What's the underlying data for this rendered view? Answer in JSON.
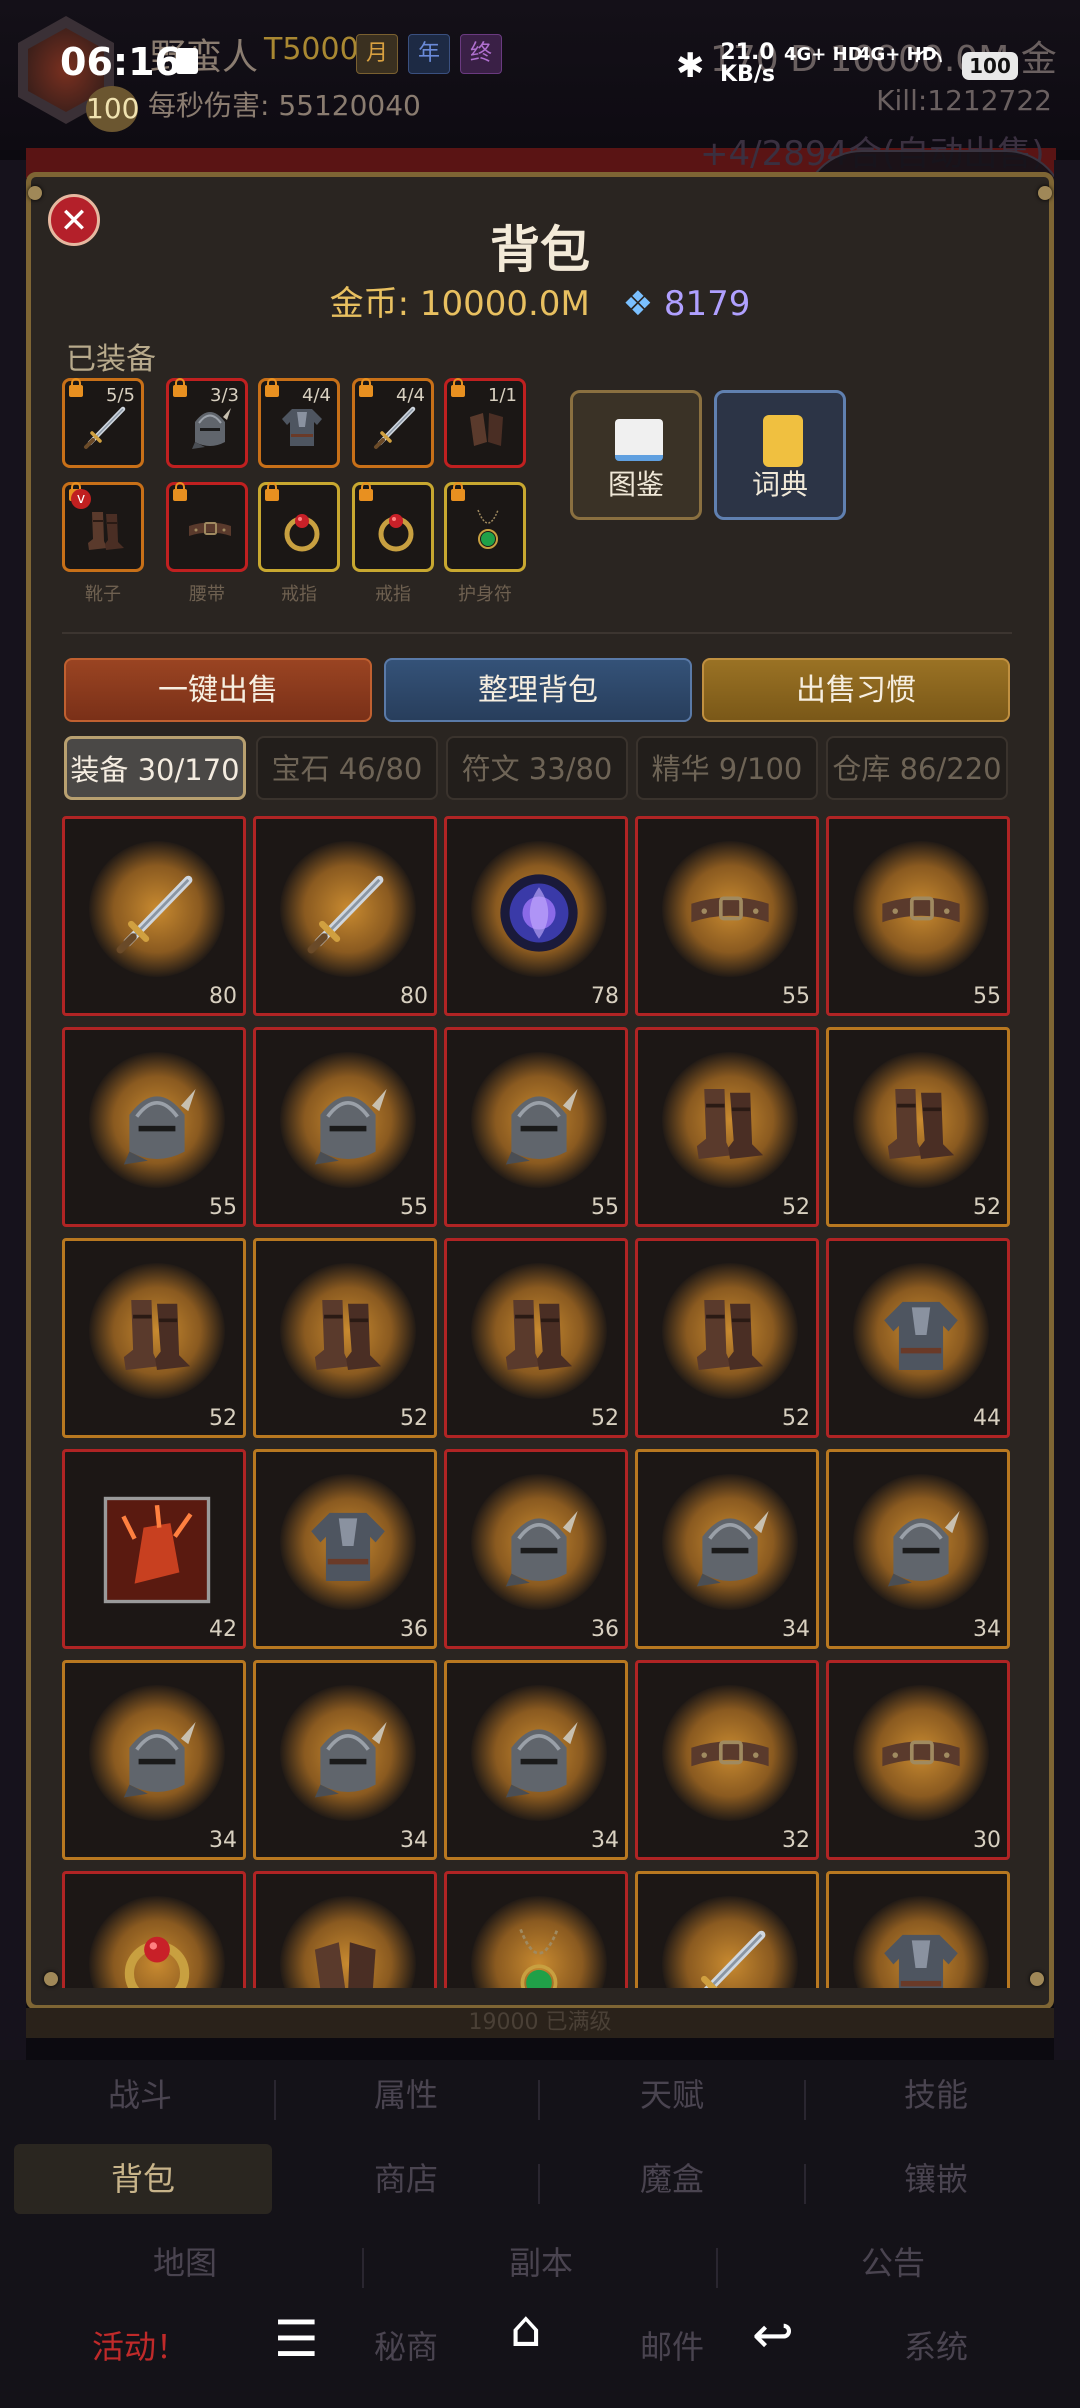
{
  "status": {
    "time": "06:16",
    "speed_top": "21.0",
    "speed_bottom": "KB/s",
    "signal1": "4G+ HD",
    "signal2": "4G+ HD",
    "battery": "100"
  },
  "header": {
    "player_name": "野蛮人",
    "tier": "T5000",
    "pill_month": "月",
    "pill_year": "年",
    "pill_life": "终",
    "level": "100",
    "dps": "每秒伤害: 55120040",
    "gold": "170 D   10000.0M 金",
    "kill": "Kill:1212722",
    "behind_text": "+4/2894合(自动出售)"
  },
  "panel": {
    "title": "背包",
    "gold_label": "金币: 10000.0M",
    "gem_value": "8179",
    "equipped_label": "已装备",
    "book_label": "图鉴",
    "dict_label": "词典",
    "actions": [
      "一键出售",
      "整理背包",
      "出售习惯"
    ],
    "tabs": [
      "装备 30/170",
      "宝石 46/80",
      "符文 33/80",
      "精华 9/100",
      "仓库 86/220"
    ],
    "bottom_under": "19000 已满级"
  },
  "equipped": [
    {
      "type": "sword",
      "count": "5/5",
      "border": "orange",
      "caption": ""
    },
    {
      "type": "helmet",
      "count": "3/3",
      "border": "red",
      "caption": ""
    },
    {
      "type": "armor",
      "count": "4/4",
      "border": "orange",
      "caption": ""
    },
    {
      "type": "sword",
      "count": "4/4",
      "border": "orange",
      "caption": ""
    },
    {
      "type": "gloves",
      "count": "1/1",
      "border": "red",
      "caption": ""
    },
    {
      "type": "boots",
      "count": "",
      "border": "orange",
      "caption": "靴子"
    },
    {
      "type": "belt",
      "count": "",
      "border": "red",
      "caption": "腰带"
    },
    {
      "type": "ring",
      "count": "",
      "border": "gold",
      "caption": "戒指"
    },
    {
      "type": "ring",
      "count": "",
      "border": "gold",
      "caption": "戒指"
    },
    {
      "type": "amulet",
      "count": "",
      "border": "gold",
      "caption": "护身符"
    }
  ],
  "items": [
    {
      "type": "sword",
      "level": "80",
      "border": "red"
    },
    {
      "type": "sword",
      "level": "80",
      "border": "red"
    },
    {
      "type": "orb",
      "level": "78",
      "border": "red"
    },
    {
      "type": "belt",
      "level": "55",
      "border": "red"
    },
    {
      "type": "belt",
      "level": "55",
      "border": "red"
    },
    {
      "type": "helmet",
      "level": "55",
      "border": "red"
    },
    {
      "type": "helmet",
      "level": "55",
      "border": "red"
    },
    {
      "type": "helmet",
      "level": "55",
      "border": "red"
    },
    {
      "type": "boots",
      "level": "52",
      "border": "red"
    },
    {
      "type": "boots",
      "level": "52",
      "border": "orange"
    },
    {
      "type": "boots",
      "level": "52",
      "border": "orange"
    },
    {
      "type": "boots",
      "level": "52",
      "border": "orange"
    },
    {
      "type": "boots",
      "level": "52",
      "border": "red"
    },
    {
      "type": "boots",
      "level": "52",
      "border": "red"
    },
    {
      "type": "armor",
      "level": "44",
      "border": "red"
    },
    {
      "type": "gauntlet",
      "level": "42",
      "border": "red"
    },
    {
      "type": "armor",
      "level": "36",
      "border": "orange"
    },
    {
      "type": "helmet",
      "level": "36",
      "border": "red"
    },
    {
      "type": "helmet",
      "level": "34",
      "border": "orange"
    },
    {
      "type": "helmet",
      "level": "34",
      "border": "orange"
    },
    {
      "type": "helmet",
      "level": "34",
      "border": "orange"
    },
    {
      "type": "helmet",
      "level": "34",
      "border": "orange"
    },
    {
      "type": "helmet",
      "level": "34",
      "border": "orange"
    },
    {
      "type": "belt",
      "level": "32",
      "border": "red"
    },
    {
      "type": "belt",
      "level": "30",
      "border": "red"
    },
    {
      "type": "ring",
      "level": "",
      "border": "red"
    },
    {
      "type": "gloves",
      "level": "",
      "border": "red"
    },
    {
      "type": "amulet",
      "level": "",
      "border": "red"
    },
    {
      "type": "sword",
      "level": "",
      "border": "orange"
    },
    {
      "type": "armor",
      "level": "",
      "border": "orange"
    }
  ],
  "nav": {
    "row1": [
      "战斗",
      "属性",
      "天赋",
      "技能"
    ],
    "row2": [
      "背包",
      "商店",
      "魔盒",
      "镶嵌"
    ],
    "row3": [
      "地图",
      "副本",
      "公告"
    ],
    "row4": [
      "活动！",
      "秘商",
      "邮件",
      "系统"
    ]
  }
}
